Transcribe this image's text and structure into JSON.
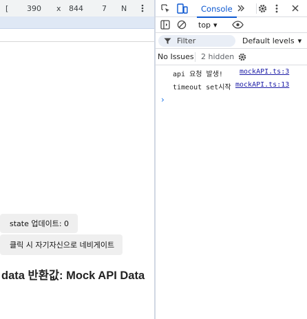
{
  "device_toolbar": {
    "device_label": "[",
    "width": "390",
    "times": "x",
    "height": "844",
    "zoom": "7",
    "throttle": "N"
  },
  "page": {
    "state_button": "state 업데이트: 0",
    "nav_button": "클릭 시 자기자신으로 네비게이트",
    "heading": "data 반환값: Mock API Data"
  },
  "devtools": {
    "tabs": {
      "console": "Console"
    },
    "toolbar": {
      "context": "top",
      "context_arrow": "▾"
    },
    "filter": {
      "placeholder": "Filter",
      "levels": "Default levels",
      "levels_arrow": "▾"
    },
    "issues": {
      "no_issues": "No Issues",
      "hidden": "2 hidden"
    },
    "logs": [
      {
        "message": "api 요청 발생!",
        "source": "mockAPI.ts:3"
      },
      {
        "message": "timeout set시작",
        "source": "mockAPI.ts:13"
      }
    ],
    "prompt": "›"
  },
  "colors": {
    "accent": "#0b57d0",
    "link": "#1a1aa6",
    "ruler": "#dfe8f5"
  }
}
